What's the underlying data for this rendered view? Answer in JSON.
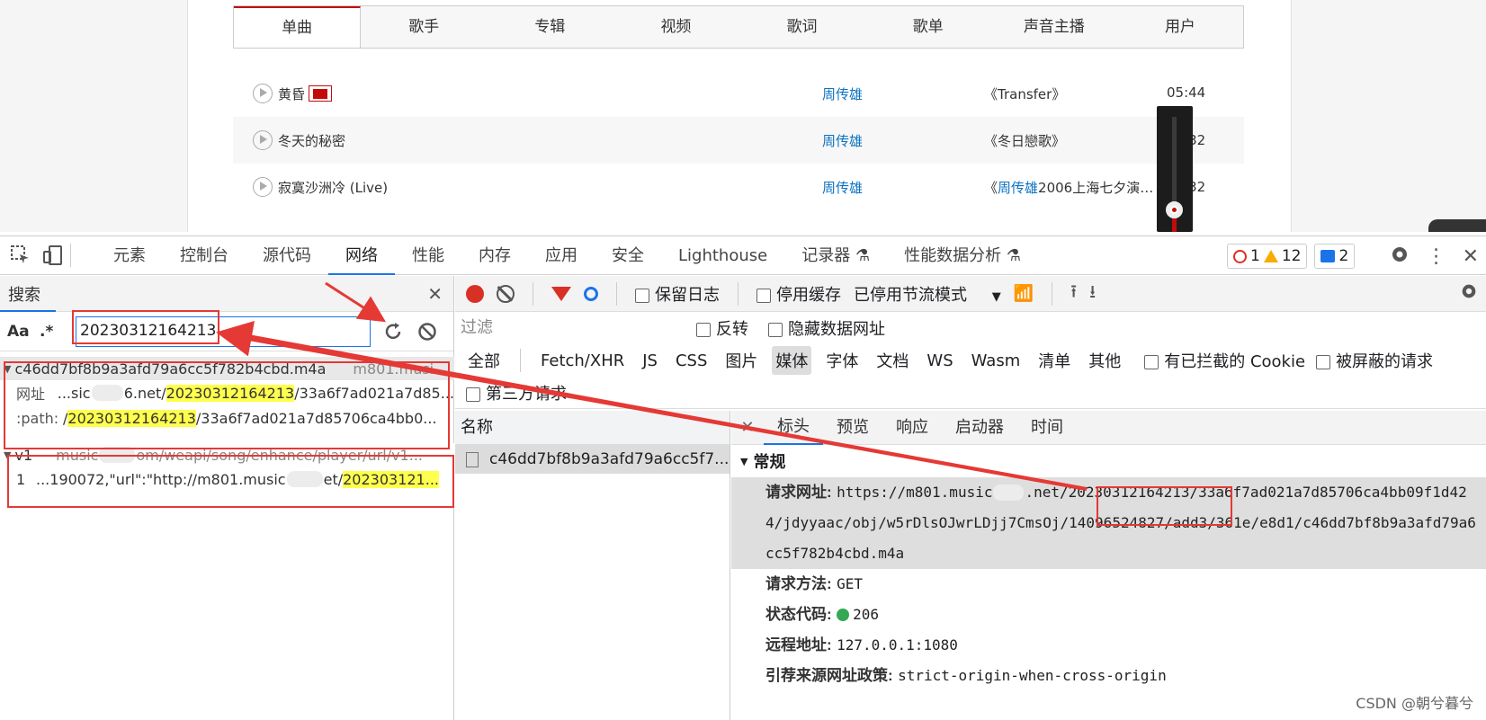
{
  "web": {
    "tabs": [
      "单曲",
      "歌手",
      "专辑",
      "视频",
      "歌词",
      "歌单",
      "声音主播",
      "用户"
    ],
    "songs": [
      {
        "name": "黄昏",
        "artist": "周传雄",
        "album": "《Transfer》",
        "duration": "05:44"
      },
      {
        "name": "冬天的秘密",
        "artist": "周传雄",
        "album": "《冬日戀歌》",
        "duration": "04:32"
      },
      {
        "name": "寂寞沙洲冷 (Live)",
        "artist": "周传雄",
        "album_pre": "《",
        "album_hl": "周传雄",
        "album_post": "2006上海七夕演…",
        "duration": "04:32"
      }
    ]
  },
  "devtools": {
    "tabs": [
      "元素",
      "控制台",
      "源代码",
      "网络",
      "性能",
      "内存",
      "应用",
      "安全",
      "Lighthouse",
      "记录器",
      "性能数据分析"
    ],
    "badges": {
      "errors": "1",
      "warnings": "12",
      "messages": "2"
    },
    "search": {
      "title": "搜索",
      "aa": "Aa",
      "regex": ".*",
      "query": "20230312164213",
      "results": [
        {
          "file": "c46dd7bf8b9a3afd79a6cc5f782b4cbd.m4a",
          "host": "m801.musi",
          "lines": [
            {
              "key": "网址",
              "pre": "...sic",
              "mid": "6.net/",
              "hl": "20230312164213",
              "post": "/33a6f7ad021a7d85..."
            },
            {
              "key": ":path:",
              "pre": "/",
              "mid": "",
              "hl": "20230312164213",
              "post": "/33a6f7ad021a7d85706ca4bb0..."
            }
          ]
        },
        {
          "file": "v1",
          "host": "music",
          "path": "om/weapi/song/enhance/player/url/v1...",
          "lines": [
            {
              "key": "1",
              "pre": "...190072,\"url\":\"http://m801.music",
              "mid": "et/",
              "hl": "202303121...",
              "post": ""
            }
          ]
        }
      ]
    },
    "network": {
      "preserve_log": "保留日志",
      "disable_cache": "停用缓存",
      "throttle": "已停用节流模式",
      "filter_placeholder": "过滤",
      "invert": "反转",
      "hide_data_urls": "隐藏数据网址",
      "types": [
        "全部",
        "Fetch/XHR",
        "JS",
        "CSS",
        "图片",
        "媒体",
        "字体",
        "文档",
        "WS",
        "Wasm",
        "清单",
        "其他"
      ],
      "blocked_cookies": "有已拦截的 Cookie",
      "blocked_requests": "被屏蔽的请求",
      "third_party": "第三方请求",
      "name_header": "名称",
      "request_name": "c46dd7bf8b9a3afd79a6cc5f7...",
      "detail_tabs": [
        "标头",
        "预览",
        "响应",
        "启动器",
        "时间"
      ],
      "general_title": "常规",
      "general": {
        "url_label": "请求网址:",
        "url_pre": "https://m801.music",
        "url_mid": ".net/",
        "url_hl": "20230312164213",
        "url_post": "/33a6f7ad021a7d85706ca4bb09f1d424/jdyyaac/obj/w5rDlsOJwrLDjj7CmsOj/14096524827/add3/361e/e8d1/c46dd7bf8b9a3afd79a6cc5f782b4cbd.m4a",
        "method_label": "请求方法:",
        "method": "GET",
        "status_label": "状态代码:",
        "status": "206",
        "remote_label": "远程地址:",
        "remote": "127.0.0.1:1080",
        "referrer_label": "引荐来源网址政策:",
        "referrer": "strict-origin-when-cross-origin"
      }
    }
  },
  "watermark": "CSDN @朝兮暮兮",
  "colors": {
    "accent": "#1a73e8",
    "highlight": "#ffff4d",
    "annotation": "#e53935",
    "link": "#0c73c2"
  }
}
